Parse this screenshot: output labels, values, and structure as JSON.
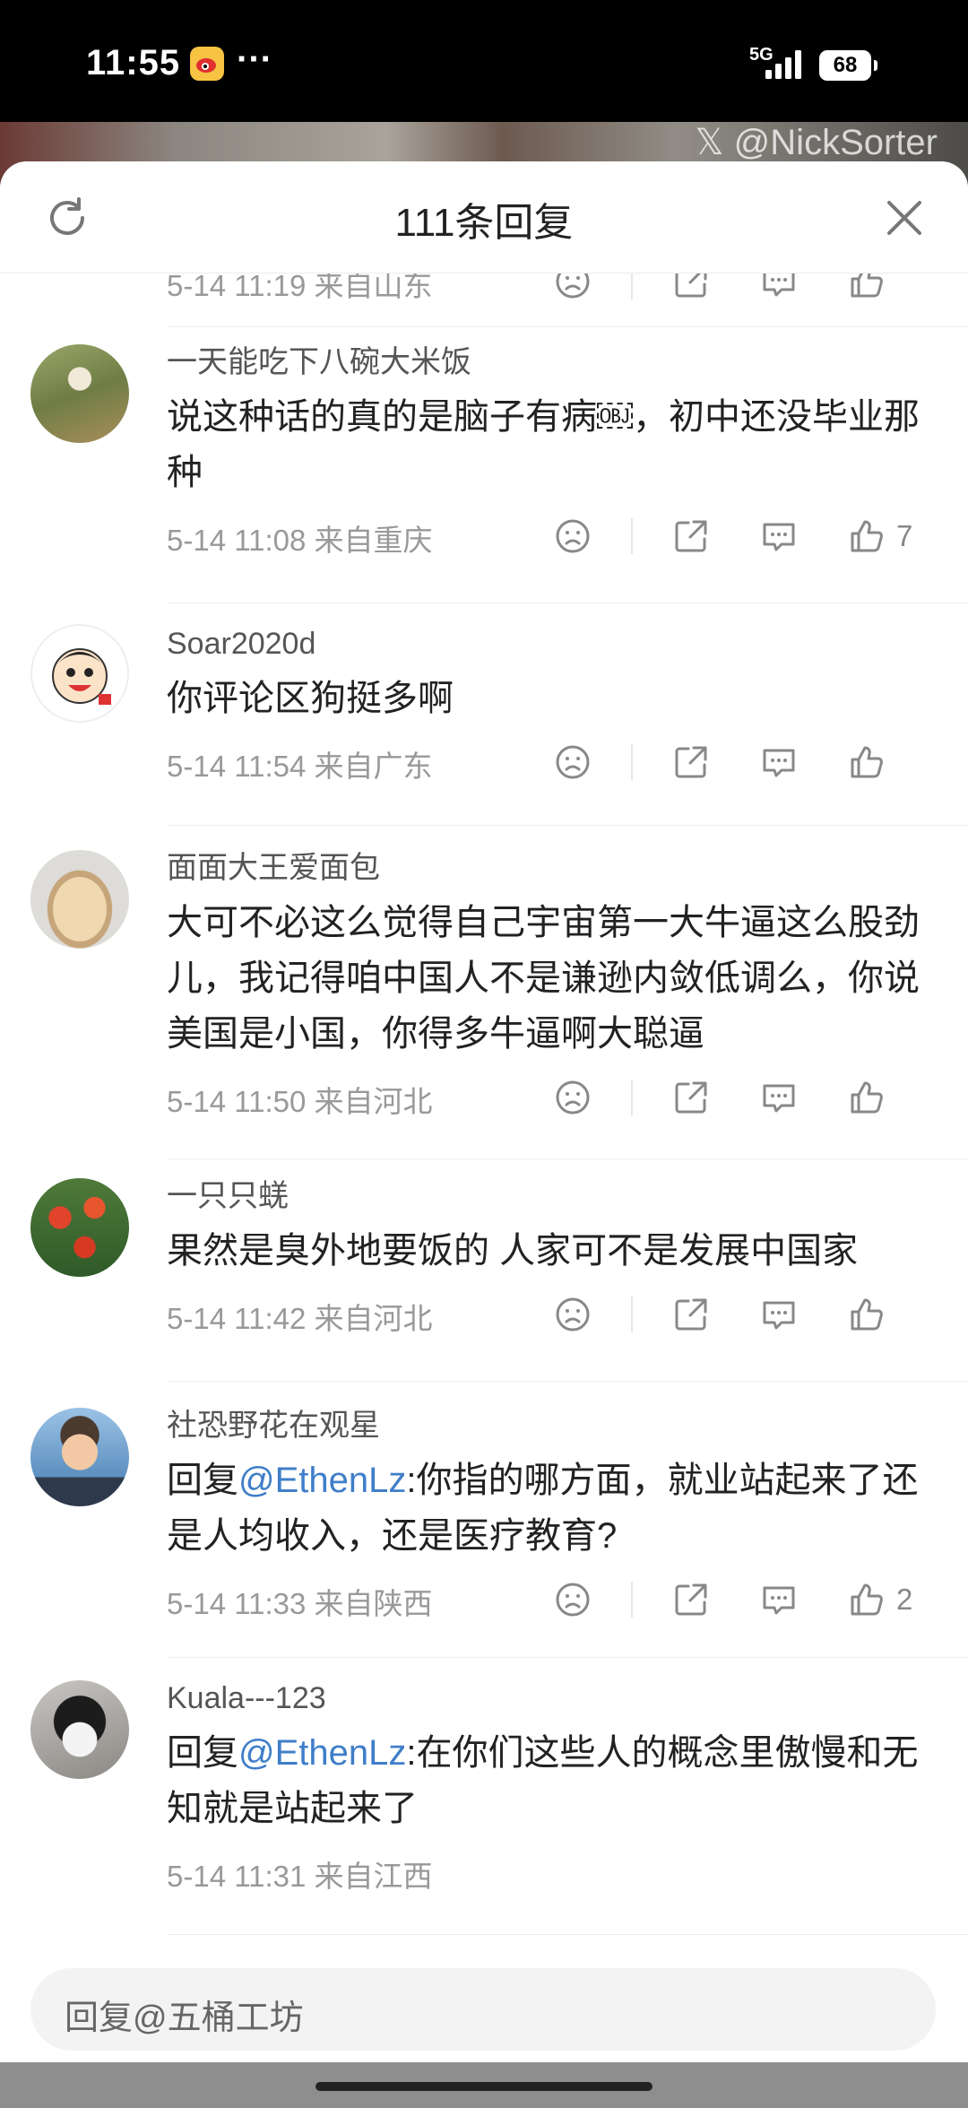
{
  "status_bar": {
    "time": "11:55",
    "dots": "···",
    "network": "5G",
    "battery": "68"
  },
  "video": {
    "watermark": "𝕏 @NickSorter"
  },
  "sheet": {
    "title": "111条回复",
    "refresh_icon": "refresh-icon",
    "close_icon": "close-icon"
  },
  "partial_top": {
    "meta": "5-14 11:19 来自山东"
  },
  "comments": [
    {
      "user": "一天能吃下八碗大米饭",
      "text": "说这种话的真的是脑子有病￼，初中还没毕业那种",
      "meta": "5-14 11:08 来自重庆",
      "likes": "7"
    },
    {
      "user": "Soar2020d",
      "text": "你评论区狗挺多啊",
      "meta": "5-14 11:54 来自广东",
      "likes": ""
    },
    {
      "user": "面面大王爱面包",
      "text": "大可不必这么觉得自己宇宙第一大牛逼这么股劲儿，我记得咱中国人不是谦逊内敛低调么，你说美国是小国，你得多牛逼啊大聪逼",
      "meta": "5-14 11:50 来自河北",
      "likes": ""
    },
    {
      "user": "一只只蜣",
      "text": "果然是臭外地要饭的 人家可不是发展中国家",
      "meta": "5-14 11:42 来自河北",
      "likes": ""
    },
    {
      "user": "社恐野花在观星",
      "reply_prefix": "回复",
      "mention": "@EthenLz",
      "text": ":你指的哪方面，就业站起来了还是人均收入，还是医疗教育?",
      "meta": "5-14 11:33 来自陕西",
      "likes": "2"
    },
    {
      "user": "Kuala---123",
      "reply_prefix": "回复",
      "mention": "@EthenLz",
      "text": ":在你们这些人的概念里傲慢和无知就是站起来了",
      "meta": "5-14 11:31 来自江西",
      "likes": ""
    }
  ],
  "reply_input": {
    "placeholder": "回复@五桶工坊"
  },
  "colors": {
    "mention": "#3f7ec9",
    "meta_text": "#999999",
    "background": "#ffffff"
  }
}
